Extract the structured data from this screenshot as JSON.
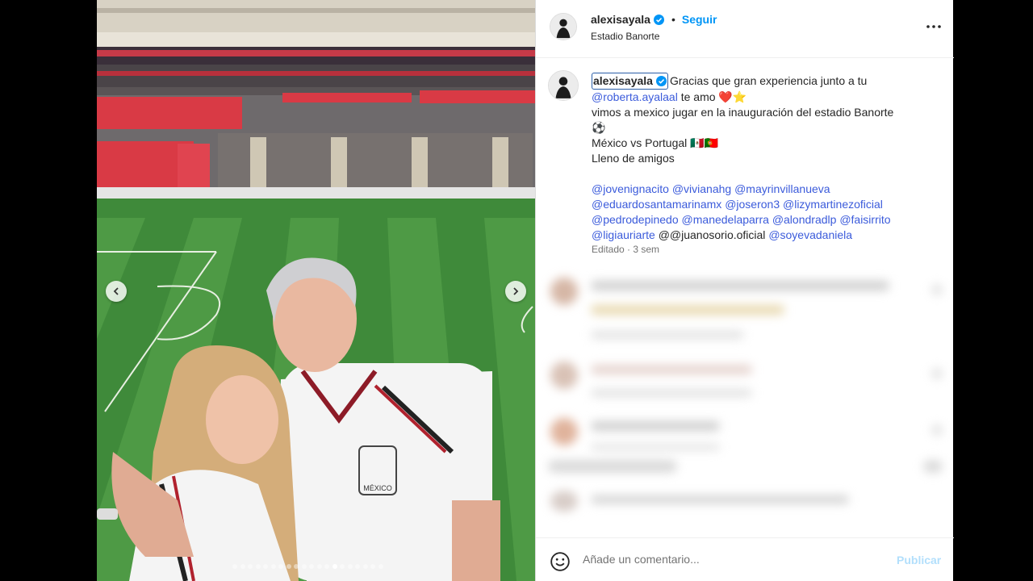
{
  "post": {
    "username": "alexisayala",
    "follow_label": "Seguir",
    "separator": "•",
    "location": "Estadio Banorte",
    "more_icon": "more-horizontal-icon",
    "verified_icon": "verified-badge-icon",
    "accent_color": "#0095f6"
  },
  "media": {
    "prev_icon": "chevron-left-icon",
    "next_icon": "chevron-right-icon",
    "slide_count": 20,
    "active_slide": 14,
    "jersey_badge_text": "MÉXICO"
  },
  "caption": {
    "username": "alexisayala",
    "line1_text": "Gracias que gran experiencia junto a tu",
    "mention_roberta": "@roberta.ayalaal",
    "line2_text": " te amo ❤️⭐️",
    "line3": "vimos a mexico jugar en la inauguración del estadio Banorte",
    "line4": "⚽️",
    "line5": "México vs Portugal 🇲🇽🇵🇹",
    "line6": "Lleno de amigos",
    "tags_row1": [
      "@jovenignacito",
      "@vivianahg",
      "@mayrinvillanueva"
    ],
    "tags_row2": [
      "@eduardosantamarinamx",
      "@joseron3",
      "@lizymartinezoficial"
    ],
    "tags_row3": [
      "@pedrodepinedo",
      "@manedelaparra",
      "@alondradlp",
      "@faisirrito"
    ],
    "tag_ligia": "@ligiauriarte",
    "tag_juan_plain": "@@juanosorio.oficial",
    "tag_soye": "@soyevadaniela",
    "edited_label": "Editado",
    "time_ago": "3 sem"
  },
  "comment_box": {
    "emoji_icon": "emoji-smile-icon",
    "placeholder": "Añade un comentario...",
    "publish_label": "Publicar"
  }
}
